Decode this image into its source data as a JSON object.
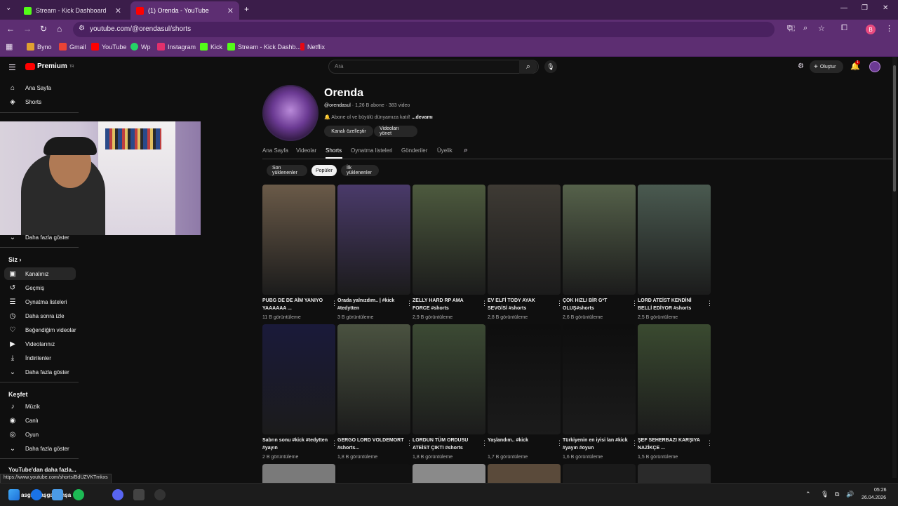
{
  "browser": {
    "tabs": [
      {
        "title": "Stream - Kick Dashboard",
        "fav_color": "#53fc18"
      },
      {
        "title": "(1) Orenda - YouTube",
        "fav_color": "#ff0000"
      }
    ],
    "url": "youtube.com/@orendasul/shorts",
    "bookmarks": [
      {
        "label": "Byno",
        "color": "#e0a030"
      },
      {
        "label": "Gmail",
        "color": "#ea4335"
      },
      {
        "label": "YouTube",
        "color": "#ff0000"
      },
      {
        "label": "Wp",
        "color": "#25d366"
      },
      {
        "label": "Instagram",
        "color": "#e1306c"
      },
      {
        "label": "Kick",
        "color": "#53fc18"
      },
      {
        "label": "Stream - Kick Dashb...",
        "color": "#53fc18"
      },
      {
        "label": "Netflix",
        "color": "#e50914"
      }
    ],
    "profile_initial": "B"
  },
  "youtube": {
    "logo": "Premium",
    "logo_sup": "TR",
    "search_placeholder": "Ara",
    "create_label": "Oluştur",
    "notif_count": "1"
  },
  "sidebar": {
    "top": [
      {
        "label": "Ana Sayfa",
        "icon": "home-icon",
        "glyph": "⌂"
      },
      {
        "label": "Shorts",
        "icon": "shorts-icon",
        "glyph": "◈"
      }
    ],
    "more1": "Daha fazla göster",
    "you_heading": "Siz",
    "you_items": [
      {
        "label": "Kanalınız",
        "icon": "channel-icon",
        "glyph": "▣"
      },
      {
        "label": "Geçmiş",
        "icon": "history-icon",
        "glyph": "↺"
      },
      {
        "label": "Oynatma listeleri",
        "icon": "playlist-icon",
        "glyph": "☰"
      },
      {
        "label": "Daha sonra izle",
        "icon": "watch-later-icon",
        "glyph": "◷"
      },
      {
        "label": "Beğendiğim videolar",
        "icon": "like-icon",
        "glyph": "♡"
      },
      {
        "label": "Videolarınız",
        "icon": "your-videos-icon",
        "glyph": "▶"
      },
      {
        "label": "İndirilenler",
        "icon": "download-icon",
        "glyph": "⤓"
      },
      {
        "label": "Daha fazla göster",
        "icon": "chevron-down-icon",
        "glyph": "⌄"
      }
    ],
    "explore_heading": "Keşfet",
    "explore_items": [
      {
        "label": "Müzik",
        "icon": "music-icon",
        "glyph": "♪"
      },
      {
        "label": "Canlı",
        "icon": "live-icon",
        "glyph": "◉"
      },
      {
        "label": "Oyun",
        "icon": "gaming-icon",
        "glyph": "◎"
      },
      {
        "label": "Daha fazla göster",
        "icon": "chevron-down-icon",
        "glyph": "⌄"
      }
    ],
    "footer_heading": "YouTube'dan daha fazla..."
  },
  "channel": {
    "name": "Orenda",
    "handle": "@orendasul",
    "meta": " · 1,26 B abone · 383 video",
    "description": "Abone ol ve büyülü dünyamıza katıl! ",
    "more_label": "...devamı",
    "customize_label": "Kanalı özelleştir",
    "manage_label": "Videoları yönet",
    "tabs": [
      "Ana Sayfa",
      "Videolar",
      "Shorts",
      "Oynatma listeleri",
      "Gönderiler",
      "Üyelik"
    ],
    "filters": [
      "Son yüklenenler",
      "Popüler",
      "İlk yüklenenler"
    ]
  },
  "shorts": [
    {
      "title": "PUBG DE DE AİM YANIYO YAAAAAA ...",
      "views": "11 B görüntüleme",
      "bg": "#6a5a48"
    },
    {
      "title": "Orada yalnızdım.. | #kick #tedytten",
      "views": "3 B görüntüleme",
      "bg": "#4a3a6a"
    },
    {
      "title": "ZELLY HARD RP AMA FORCE  #shorts",
      "views": "2,9 B görüntüleme",
      "bg": "#4d5a3e"
    },
    {
      "title": "EV ELFİ TODY AYAK SEVGİSİ #shorts",
      "views": "2,8 B görüntüleme",
      "bg": "#3e3a34"
    },
    {
      "title": "ÇOK HIZLI BİR G*T OLUŞ#shorts",
      "views": "2,6 B görüntüleme",
      "bg": "#55614a"
    },
    {
      "title": "LORD ATEİST KENDİNİ BELLİ EDİYOR #shorts",
      "views": "2,5 B görüntüleme",
      "bg": "#4a5a50"
    },
    {
      "title": "Sabrın sonu  #kick #tedytten #yayın",
      "views": "2 B görüntüleme",
      "bg": "#1a1a3a"
    },
    {
      "title": "GERGO LORD VOLDEMORT  #shorts...",
      "views": "1,8 B görüntüleme",
      "bg": "#4a5240"
    },
    {
      "title": "LORDUN TÜM ORDUSU ATEİST ÇIKTI #shorts",
      "views": "1,8 B görüntüleme",
      "bg": "#3c4a34"
    },
    {
      "title": "Yaşlandım.. #kick",
      "views": "1,7 B görüntüleme",
      "bg": "#0e0e0e"
    },
    {
      "title": "Türkiyenin en iyisi lan #kick #yayın #oyun",
      "views": "1,6 B görüntüleme",
      "bg": "#0e0e0e"
    },
    {
      "title": "ŞEF SEHERBAZI KARŞIYA NAZİKÇE ...",
      "views": "1,5 B görüntüleme",
      "bg": "#3a4a30"
    }
  ],
  "status_url": "https://www.youtube.com/shorts/BdUZVKTmkxs",
  "taskbar": {
    "time": "05:26",
    "date": "26.04.2026",
    "ticker": "asgikmaşgakgmşa"
  }
}
